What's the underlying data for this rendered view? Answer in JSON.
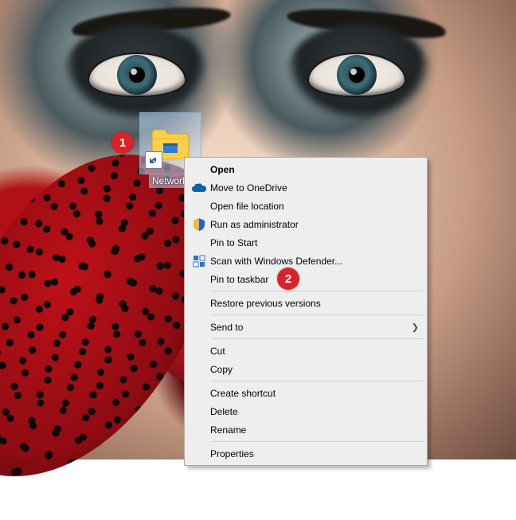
{
  "desktop_icon": {
    "label": "Network"
  },
  "menu": {
    "items": [
      {
        "label": "Open",
        "bold": true,
        "icon": null,
        "submenu": false
      },
      {
        "label": "Move to OneDrive",
        "bold": false,
        "icon": "onedrive-icon",
        "submenu": false
      },
      {
        "label": "Open file location",
        "bold": false,
        "icon": null,
        "submenu": false
      },
      {
        "label": "Run as administrator",
        "bold": false,
        "icon": "shield-icon",
        "submenu": false
      },
      {
        "label": "Pin to Start",
        "bold": false,
        "icon": null,
        "submenu": false
      },
      {
        "label": "Scan with Windows Defender...",
        "bold": false,
        "icon": "defender-icon",
        "submenu": false
      },
      {
        "label": "Pin to taskbar",
        "bold": false,
        "icon": null,
        "submenu": false
      },
      {
        "sep": true
      },
      {
        "label": "Restore previous versions",
        "bold": false,
        "icon": null,
        "submenu": false
      },
      {
        "sep": true
      },
      {
        "label": "Send to",
        "bold": false,
        "icon": null,
        "submenu": true
      },
      {
        "sep": true
      },
      {
        "label": "Cut",
        "bold": false,
        "icon": null,
        "submenu": false
      },
      {
        "label": "Copy",
        "bold": false,
        "icon": null,
        "submenu": false
      },
      {
        "sep": true
      },
      {
        "label": "Create shortcut",
        "bold": false,
        "icon": null,
        "submenu": false
      },
      {
        "label": "Delete",
        "bold": false,
        "icon": null,
        "submenu": false
      },
      {
        "label": "Rename",
        "bold": false,
        "icon": null,
        "submenu": false
      },
      {
        "sep": true
      },
      {
        "label": "Properties",
        "bold": false,
        "icon": null,
        "submenu": false
      }
    ]
  },
  "callouts": {
    "one": "1",
    "two": "2"
  }
}
